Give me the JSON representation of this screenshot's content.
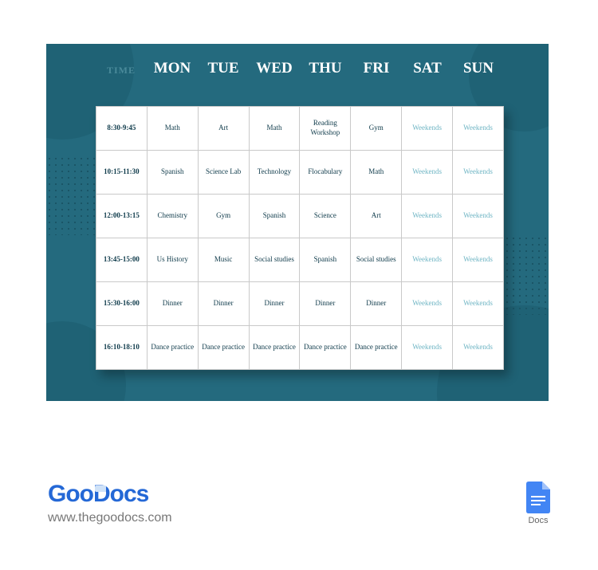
{
  "schedule": {
    "time_header": "TIME",
    "days": [
      "MON",
      "TUE",
      "WED",
      "THU",
      "FRI",
      "SAT",
      "SUN"
    ],
    "rows": [
      {
        "time": "8:30-9:45",
        "cells": [
          "Math",
          "Art",
          "Math",
          "Reading Workshop",
          "Gym",
          "Weekends",
          "Weekends"
        ]
      },
      {
        "time": "10:15-11:30",
        "cells": [
          "Spanish",
          "Science Lab",
          "Technology",
          "Flocabulary",
          "Math",
          "Weekends",
          "Weekends"
        ]
      },
      {
        "time": "12:00-13:15",
        "cells": [
          "Chemistry",
          "Gym",
          "Spanish",
          "Science",
          "Art",
          "Weekends",
          "Weekends"
        ]
      },
      {
        "time": "13:45-15:00",
        "cells": [
          "Us History",
          "Music",
          "Social studies",
          "Spanish",
          "Social studies",
          "Weekends",
          "Weekends"
        ]
      },
      {
        "time": "15:30-16:00",
        "cells": [
          "Dinner",
          "Dinner",
          "Dinner",
          "Dinner",
          "Dinner",
          "Weekends",
          "Weekends"
        ]
      },
      {
        "time": "16:10-18:10",
        "cells": [
          "Dance practice",
          "Dance practice",
          "Dance practice",
          "Dance practice",
          "Dance practice",
          "Weekends",
          "Weekends"
        ]
      }
    ]
  },
  "footer": {
    "brand_pre": "Goo",
    "brand_d": "D",
    "brand_post": "ocs",
    "url": "www.thegoodocs.com",
    "docs_label": "Docs"
  }
}
